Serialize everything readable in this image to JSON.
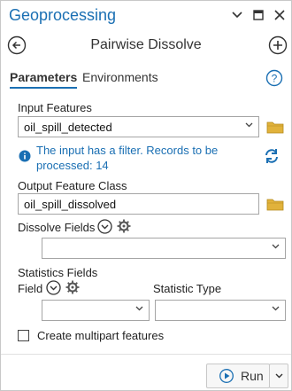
{
  "window": {
    "title": "Geoprocessing",
    "controls": [
      "chevron-down-icon",
      "restore-icon",
      "close-icon"
    ]
  },
  "header": {
    "title": "Pairwise Dissolve"
  },
  "tabs": [
    {
      "label": "Parameters",
      "active": true
    },
    {
      "label": "Environments",
      "active": false
    }
  ],
  "input_features": {
    "label": "Input Features",
    "value": "oil_spill_detected"
  },
  "filter_message": "The input has a filter. Records to be processed: 14",
  "output_feature_class": {
    "label": "Output Feature Class",
    "value": "oil_spill_dissolved"
  },
  "dissolve_fields": {
    "label": "Dissolve Fields",
    "value": ""
  },
  "statistics_fields": {
    "label": "Statistics Fields",
    "field_label": "Field",
    "statistic_type_label": "Statistic Type",
    "field_value": "",
    "statistic_type_value": ""
  },
  "multipart": {
    "label": "Create multipart features",
    "checked": false
  },
  "footer": {
    "run_label": "Run"
  },
  "colors": {
    "accent": "#1a6fb3",
    "folder": "#e1b23b",
    "text": "#1f1f1f"
  }
}
